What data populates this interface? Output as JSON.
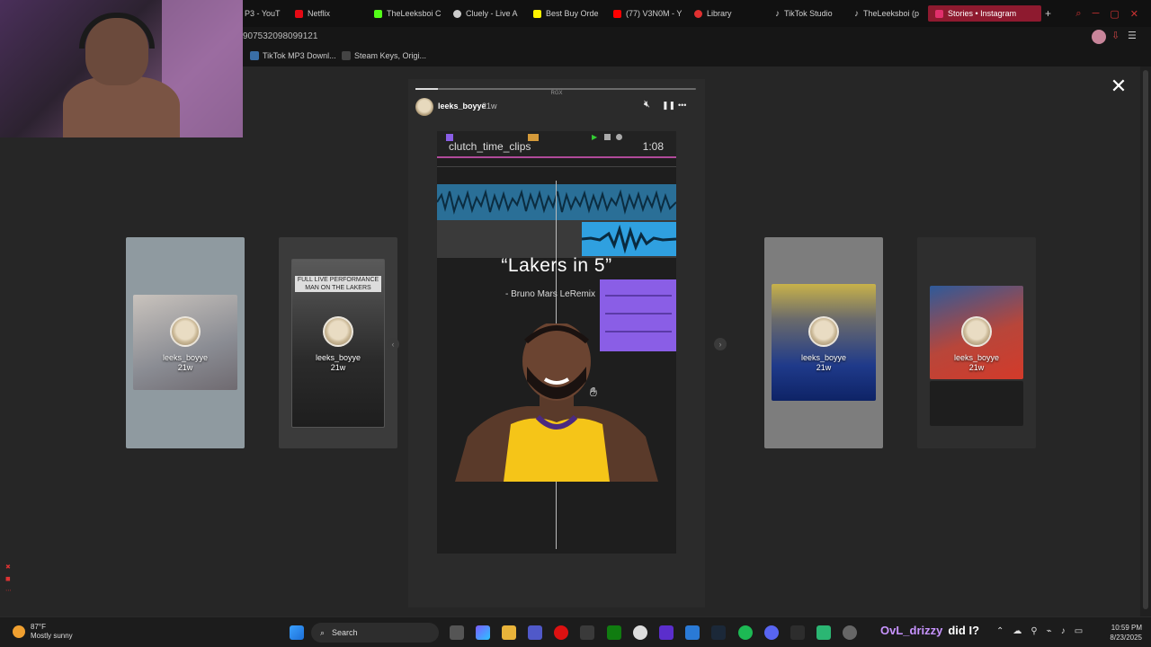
{
  "browser": {
    "tabs": [
      {
        "label": "P3 - YouT",
        "color": "#ff0000"
      },
      {
        "label": "Netflix",
        "color": "#e50914"
      },
      {
        "label": "TheLeeksboi C",
        "color": "#53fc18"
      },
      {
        "label": "Cluely - Live A",
        "color": "#dddddd"
      },
      {
        "label": "Best Buy Orde",
        "color": "#fff200"
      },
      {
        "label": "(77) V3N0M - Y",
        "color": "#ff0000"
      },
      {
        "label": "Library",
        "color": "#e03030"
      },
      {
        "label": "TikTok Studio",
        "color": "#ffffff"
      },
      {
        "label": "TheLeeksboi (p",
        "color": "#ffffff"
      },
      {
        "label": "Stories • Instagram",
        "color": "#e1306c",
        "active": true
      }
    ],
    "url": "907532098099121",
    "bookmarks": [
      "TikTok MP3 Downl...",
      "Steam Keys, Origi..."
    ],
    "new_tab": "+"
  },
  "viewer": {
    "close": "✕",
    "prev": "‹",
    "next": "›",
    "side_stories": [
      {
        "user": "leeks_boyye",
        "age": "21w",
        "caption": ""
      },
      {
        "user": "leeks_boyye",
        "age": "21w",
        "caption": "FULL LIVE PERFORMANCE\nMAN ON THE LAKERS"
      },
      {
        "user": "leeks_boyye",
        "age": "21w",
        "caption": ""
      },
      {
        "user": "leeks_boyye",
        "age": "21w",
        "caption": ""
      }
    ],
    "main": {
      "watermark": "RGX",
      "user": "leeks_boyye",
      "age": "21w",
      "mute_icon": "🔇",
      "pause_icon": "❚❚",
      "more_icon": "•••",
      "daw_title": "clutch_time_clips",
      "daw_time": "1:08",
      "song_title": "“Lakers in 5”",
      "song_subtitle": "- Bruno Mars LeRemix",
      "progress": 0.08
    }
  },
  "taskbar": {
    "temperature": "87°F",
    "weather": "Mostly sunny",
    "search_placeholder": "Search",
    "time": "10:59 PM",
    "date": "8/23/2025"
  },
  "stream_overlay": {
    "chat_user": "OvL_drizzy",
    "chat_message": "did I?"
  },
  "colors": {
    "accent": "#8e1a2f",
    "daw_blue": "#2a6f97",
    "daw_light_blue": "#2fa0e0",
    "daw_purple": "#8a5ee6",
    "lakers_gold": "#f5c518"
  }
}
